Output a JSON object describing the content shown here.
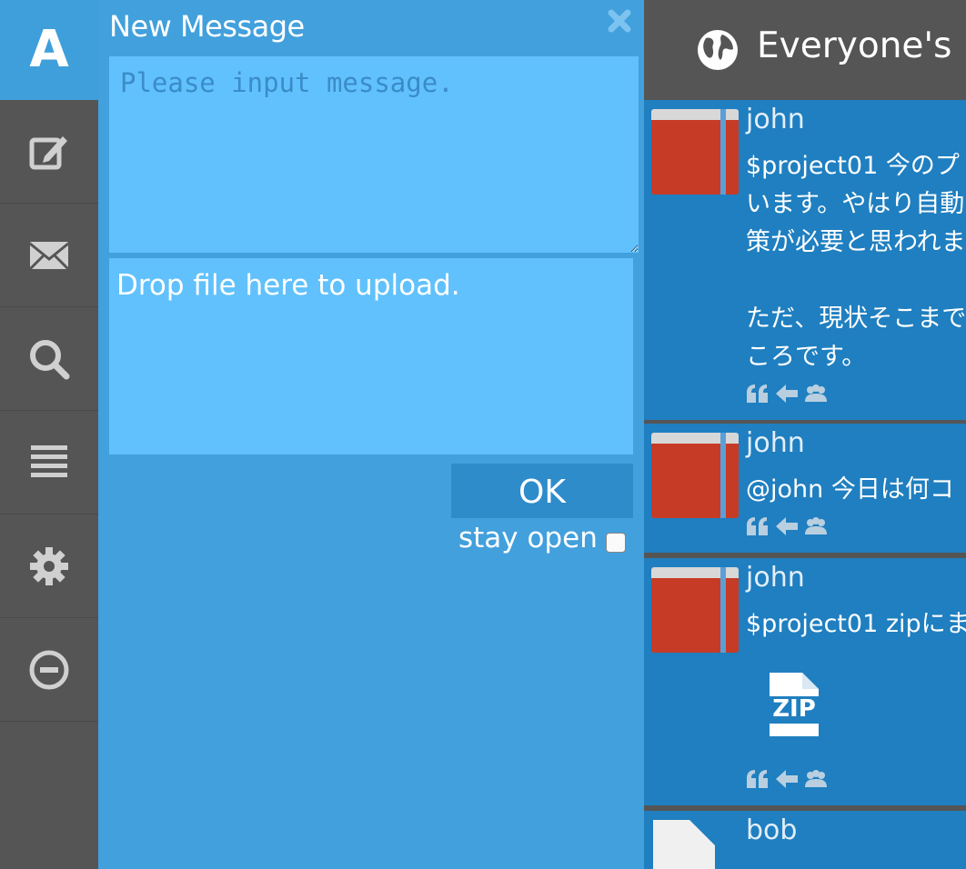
{
  "app": {
    "logo": "A"
  },
  "sidebar": {
    "items": [
      {
        "icon": "compose-icon"
      },
      {
        "icon": "mail-icon"
      },
      {
        "icon": "search-icon"
      },
      {
        "icon": "list-icon"
      },
      {
        "icon": "gear-icon"
      },
      {
        "icon": "minus-circle-icon"
      }
    ]
  },
  "compose": {
    "title": "New Message",
    "message_placeholder": "Please input message.",
    "drop_text": "Drop file here to upload.",
    "ok_label": "OK",
    "stay_open_label": "stay open"
  },
  "timeline": {
    "title": "Everyone's M",
    "posts": [
      {
        "user": "john",
        "text": "$project01 今のプ\nいます。やはり自動\n策が必要と思われま\n\nただ、現状そこまで\nころです。"
      },
      {
        "user": "john",
        "text": "@john 今日は何コ"
      },
      {
        "user": "john",
        "text": "$project01 zipにま",
        "attachment": "ZIP"
      },
      {
        "user": "bob",
        "text": ""
      }
    ]
  },
  "colors": {
    "accent": "#42a0dc",
    "sidebar": "#555555",
    "post_bg": "#1f7fc0"
  }
}
